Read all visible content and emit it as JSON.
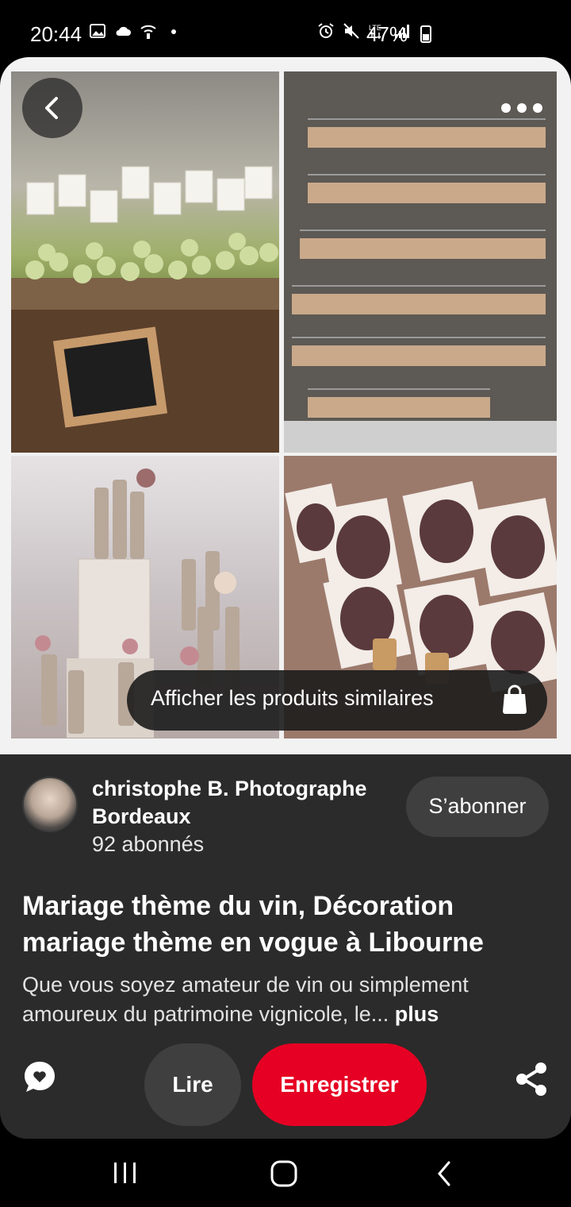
{
  "status_bar": {
    "time": "20:44",
    "battery": "47%",
    "left_icons": [
      "gallery-icon",
      "cloud-icon",
      "wifi-calling-icon",
      "dot-icon"
    ],
    "right_icons": [
      "alarm-icon",
      "mute-icon",
      "lte-icon",
      "signal-icon",
      "battery-icon"
    ]
  },
  "pin": {
    "image_alt": "wedding wine theme collage: grapes with place cards and 'find your seat' sign, wine cork keychains board, painted bottles with flowers, escort cards with corks",
    "similar_products_label": "Afficher les produits similaires"
  },
  "creator": {
    "name": "christophe B. Photographe Bordeaux",
    "followers": "92 abonnés",
    "follow_label": "S’abonner"
  },
  "content": {
    "title": "Mariage thème du vin, Décoration mariage thème en vogue à Libourne",
    "description": "Que vous soyez amateur de vin ou simplement amoureux du patrimoine vignicole, le...",
    "more_label": "plus"
  },
  "actions": {
    "read_label": "Lire",
    "save_label": "Enregistrer"
  },
  "colors": {
    "accent_red": "#e60023",
    "card_bg": "#2b2b2b",
    "pill_bg": "#3f3f3f"
  }
}
